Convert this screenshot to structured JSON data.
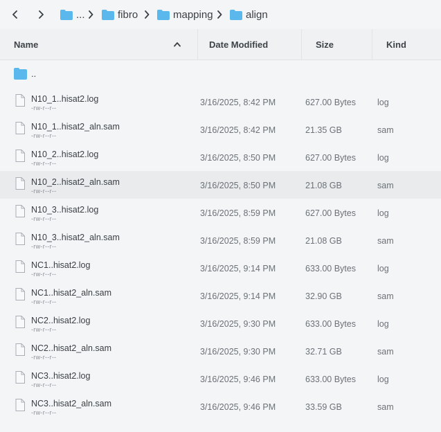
{
  "toolbar": {
    "back_icon": "chevron-left-icon",
    "forward_icon": "chevron-right-icon",
    "breadcrumbs": [
      {
        "label": "...",
        "icon": "folder-icon"
      },
      {
        "label": "fibro",
        "icon": "folder-icon"
      },
      {
        "label": "mapping",
        "icon": "folder-icon"
      },
      {
        "label": "align",
        "icon": "folder-icon"
      }
    ]
  },
  "columns": {
    "name": "Name",
    "date": "Date Modified",
    "size": "Size",
    "kind": "Kind",
    "sort_icon": "chevron-up-icon"
  },
  "parent": {
    "label": ".."
  },
  "files": [
    {
      "name": "N10_1..hisat2.log",
      "perm": "-rw-r--r--",
      "date": "3/16/2025, 8:42 PM",
      "size": "627.00 Bytes",
      "kind": "log"
    },
    {
      "name": "N10_1..hisat2_aln.sam",
      "perm": "-rw-r--r--",
      "date": "3/16/2025, 8:42 PM",
      "size": "21.35 GB",
      "kind": "sam"
    },
    {
      "name": "N10_2..hisat2.log",
      "perm": "-rw-r--r--",
      "date": "3/16/2025, 8:50 PM",
      "size": "627.00 Bytes",
      "kind": "log"
    },
    {
      "name": "N10_2..hisat2_aln.sam",
      "perm": "-rw-r--r--",
      "date": "3/16/2025, 8:50 PM",
      "size": "21.08 GB",
      "kind": "sam"
    },
    {
      "name": "N10_3..hisat2.log",
      "perm": "-rw-r--r--",
      "date": "3/16/2025, 8:59 PM",
      "size": "627.00 Bytes",
      "kind": "log"
    },
    {
      "name": "N10_3..hisat2_aln.sam",
      "perm": "-rw-r--r--",
      "date": "3/16/2025, 8:59 PM",
      "size": "21.08 GB",
      "kind": "sam"
    },
    {
      "name": "NC1..hisat2.log",
      "perm": "-rw-r--r--",
      "date": "3/16/2025, 9:14 PM",
      "size": "633.00 Bytes",
      "kind": "log"
    },
    {
      "name": "NC1..hisat2_aln.sam",
      "perm": "-rw-r--r--",
      "date": "3/16/2025, 9:14 PM",
      "size": "32.90 GB",
      "kind": "sam"
    },
    {
      "name": "NC2..hisat2.log",
      "perm": "-rw-r--r--",
      "date": "3/16/2025, 9:30 PM",
      "size": "633.00 Bytes",
      "kind": "log"
    },
    {
      "name": "NC2..hisat2_aln.sam",
      "perm": "-rw-r--r--",
      "date": "3/16/2025, 9:30 PM",
      "size": "32.71 GB",
      "kind": "sam"
    },
    {
      "name": "NC3..hisat2.log",
      "perm": "-rw-r--r--",
      "date": "3/16/2025, 9:46 PM",
      "size": "633.00 Bytes",
      "kind": "log"
    },
    {
      "name": "NC3..hisat2_aln.sam",
      "perm": "-rw-r--r--",
      "date": "3/16/2025, 9:46 PM",
      "size": "33.59 GB",
      "kind": "sam"
    }
  ],
  "colors": {
    "folder": "#5bb8ec",
    "hover_row": "#e9ebed"
  }
}
